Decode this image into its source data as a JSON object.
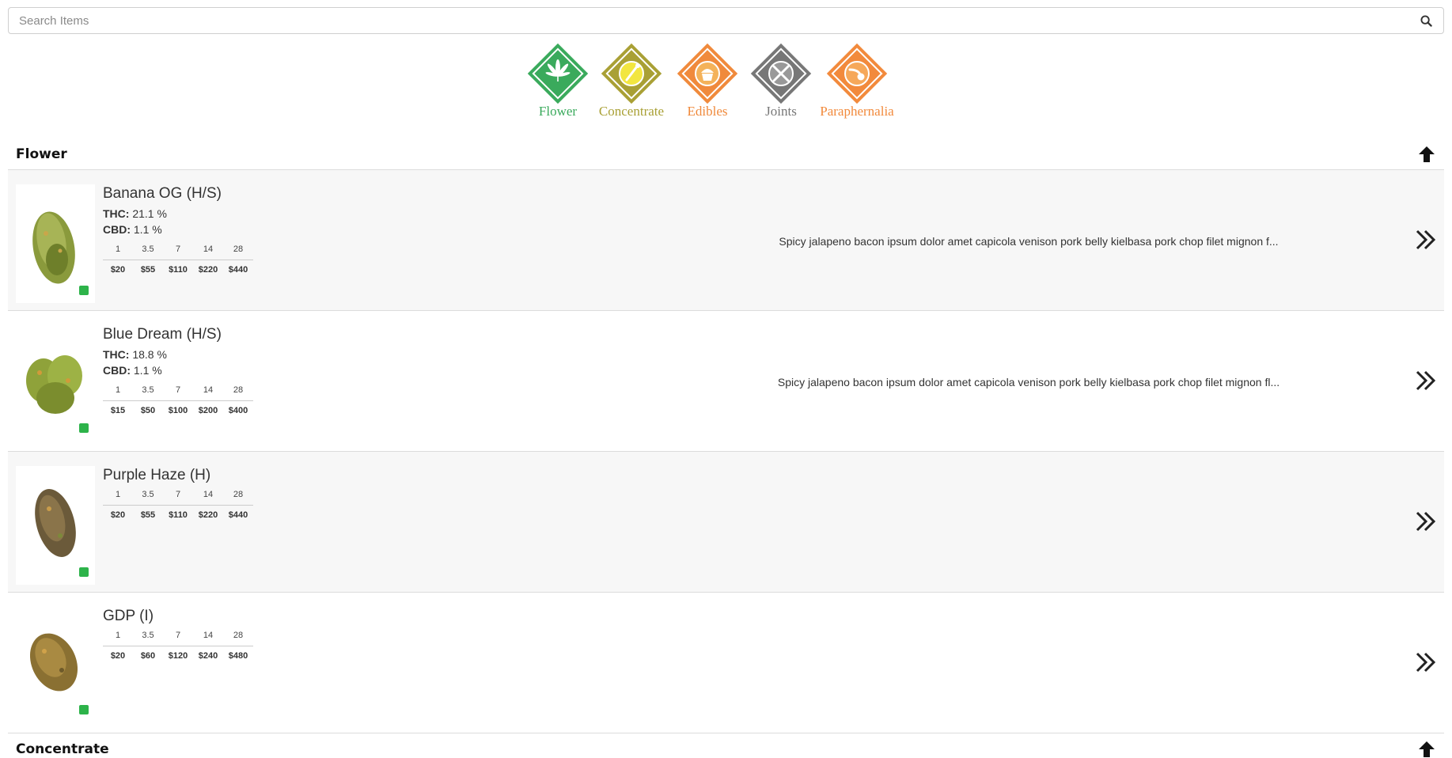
{
  "search": {
    "placeholder": "Search Items"
  },
  "categories": [
    {
      "label": "Flower",
      "color": "#3aaa5c"
    },
    {
      "label": "Concentrate",
      "color": "#a9a035"
    },
    {
      "label": "Edibles",
      "color": "#f08a3c"
    },
    {
      "label": "Joints",
      "color": "#777777"
    },
    {
      "label": "Paraphernalia",
      "color": "#f28a3c"
    }
  ],
  "sections": {
    "flower": {
      "title": "Flower"
    },
    "concentrate": {
      "title": "Concentrate"
    }
  },
  "labels": {
    "thc": "THC:",
    "cbd": "CBD:"
  },
  "size_headers": [
    "1",
    "3.5",
    "7",
    "14",
    "28"
  ],
  "products": [
    {
      "name": "Banana OG (H/S)",
      "thc": "21.1 %",
      "cbd": "1.1 %",
      "prices": [
        "$20",
        "$55",
        "$110",
        "$220",
        "$440"
      ],
      "description": "Spicy jalapeno bacon ipsum dolor amet capicola venison pork belly kielbasa pork chop filet mignon f..."
    },
    {
      "name": "Blue Dream (H/S)",
      "thc": "18.8 %",
      "cbd": "1.1 %",
      "prices": [
        "$15",
        "$50",
        "$100",
        "$200",
        "$400"
      ],
      "description": "Spicy jalapeno bacon ipsum dolor amet capicola venison pork belly kielbasa pork chop filet mignon fl..."
    },
    {
      "name": "Purple Haze (H)",
      "prices": [
        "$20",
        "$55",
        "$110",
        "$220",
        "$440"
      ]
    },
    {
      "name": "GDP (I)",
      "prices": [
        "$20",
        "$60",
        "$120",
        "$240",
        "$480"
      ]
    }
  ]
}
